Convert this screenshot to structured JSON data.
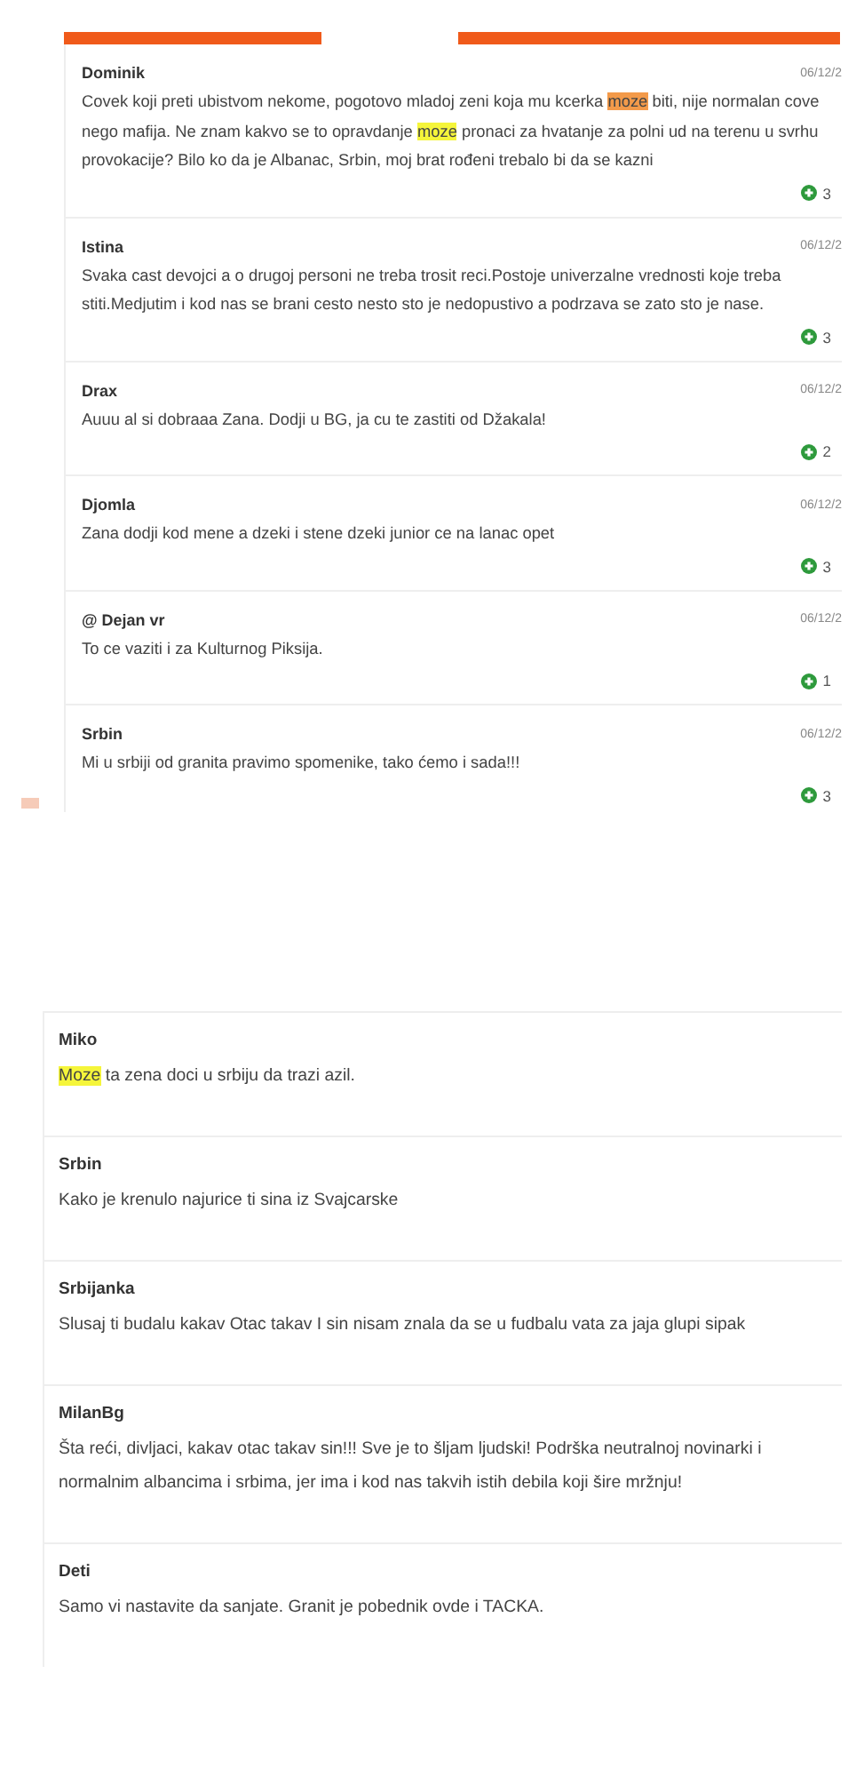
{
  "top_panel": {
    "comments": [
      {
        "author": "Dominik",
        "date": "06/12/2",
        "votes": "3",
        "lines": [
          [
            {
              "text": "Covek koji preti ubistvom nekome, pogotovo mladoj zeni koja mu kcerka ",
              "highlighted": false
            },
            {
              "text": "moze",
              "highlighted": true,
              "active": true
            },
            {
              "text": " biti, nije normalan cove",
              "highlighted": false
            }
          ],
          [
            {
              "text": "nego mafija. Ne znam kakvo se to opravdanje ",
              "highlighted": false
            },
            {
              "text": "moze",
              "highlighted": true,
              "active": false
            },
            {
              "text": " pronaci za hvatanje za polni ud na terenu u svrhu",
              "highlighted": false
            }
          ],
          [
            {
              "text": "provokacije? Bilo ko da je Albanac, Srbin, moj brat rođeni trebalo bi da se kazni",
              "highlighted": false
            }
          ]
        ]
      },
      {
        "author": "Istina",
        "date": "06/12/2",
        "votes": "3",
        "lines": [
          [
            {
              "text": "Svaka cast devojci a o drugoj personi ne treba trosit reci.Postoje univerzalne vrednosti koje treba",
              "highlighted": false
            }
          ],
          [
            {
              "text": "stiti.Medjutim i kod nas se brani cesto nesto sto je nedopustivo a podrzava se zato sto je nase.",
              "highlighted": false
            }
          ]
        ]
      },
      {
        "author": "Drax",
        "date": "06/12/2",
        "votes": "2",
        "lines": [
          [
            {
              "text": "Auuu al si dobraaa Zana. Dodji u BG, ja cu te zastiti od Džakala!",
              "highlighted": false
            }
          ]
        ]
      },
      {
        "author": "Djomla",
        "date": "06/12/2",
        "votes": "3",
        "lines": [
          [
            {
              "text": "Zana dodji kod mene a dzeki i stene dzeki junior ce na lanac opet",
              "highlighted": false
            }
          ]
        ]
      },
      {
        "author": "@ Dejan vr",
        "date": "06/12/2",
        "votes": "1",
        "lines": [
          [
            {
              "text": "To ce vaziti i za Kulturnog Piksija.",
              "highlighted": false
            }
          ]
        ]
      },
      {
        "author": "Srbin",
        "date": "06/12/2",
        "votes": "3",
        "lines": [
          [
            {
              "text": "Mi u srbiji od granita pravimo spomenike, tako ćemo i sada!!!",
              "highlighted": false
            }
          ]
        ]
      }
    ]
  },
  "bottom_panel": {
    "comments": [
      {
        "author": "Miko",
        "lines": [
          [
            {
              "text": "Moze",
              "highlighted": true,
              "active": false
            },
            {
              "text": " ta zena doci u srbiju da trazi azil.",
              "highlighted": false
            }
          ]
        ]
      },
      {
        "author": "Srbin",
        "lines": [
          [
            {
              "text": "Kako je krenulo najurice ti sina iz Svajcarske",
              "highlighted": false
            }
          ]
        ]
      },
      {
        "author": "Srbijanka",
        "lines": [
          [
            {
              "text": "Slusaj ti budalu kakav Otac takav I sin nisam znala da se u fudbalu vata za jaja glupi sipak",
              "highlighted": false
            }
          ]
        ]
      },
      {
        "author": "MilanBg",
        "lines": [
          [
            {
              "text": "Šta reći, divljaci, kakav otac takav sin!!! Sve je to šljam ljudski! Podrška neutralnoj novinarki i",
              "highlighted": false
            }
          ],
          [
            {
              "text": "normalnim albancima i srbima, jer ima i kod nas takvih istih debila koji šire mržnju!",
              "highlighted": false
            }
          ]
        ]
      },
      {
        "author": "Deti",
        "lines": [
          [
            {
              "text": "Samo vi nastavite da sanjate. Granit je pobednik ovde i TACKA.",
              "highlighted": false
            }
          ]
        ]
      }
    ]
  }
}
